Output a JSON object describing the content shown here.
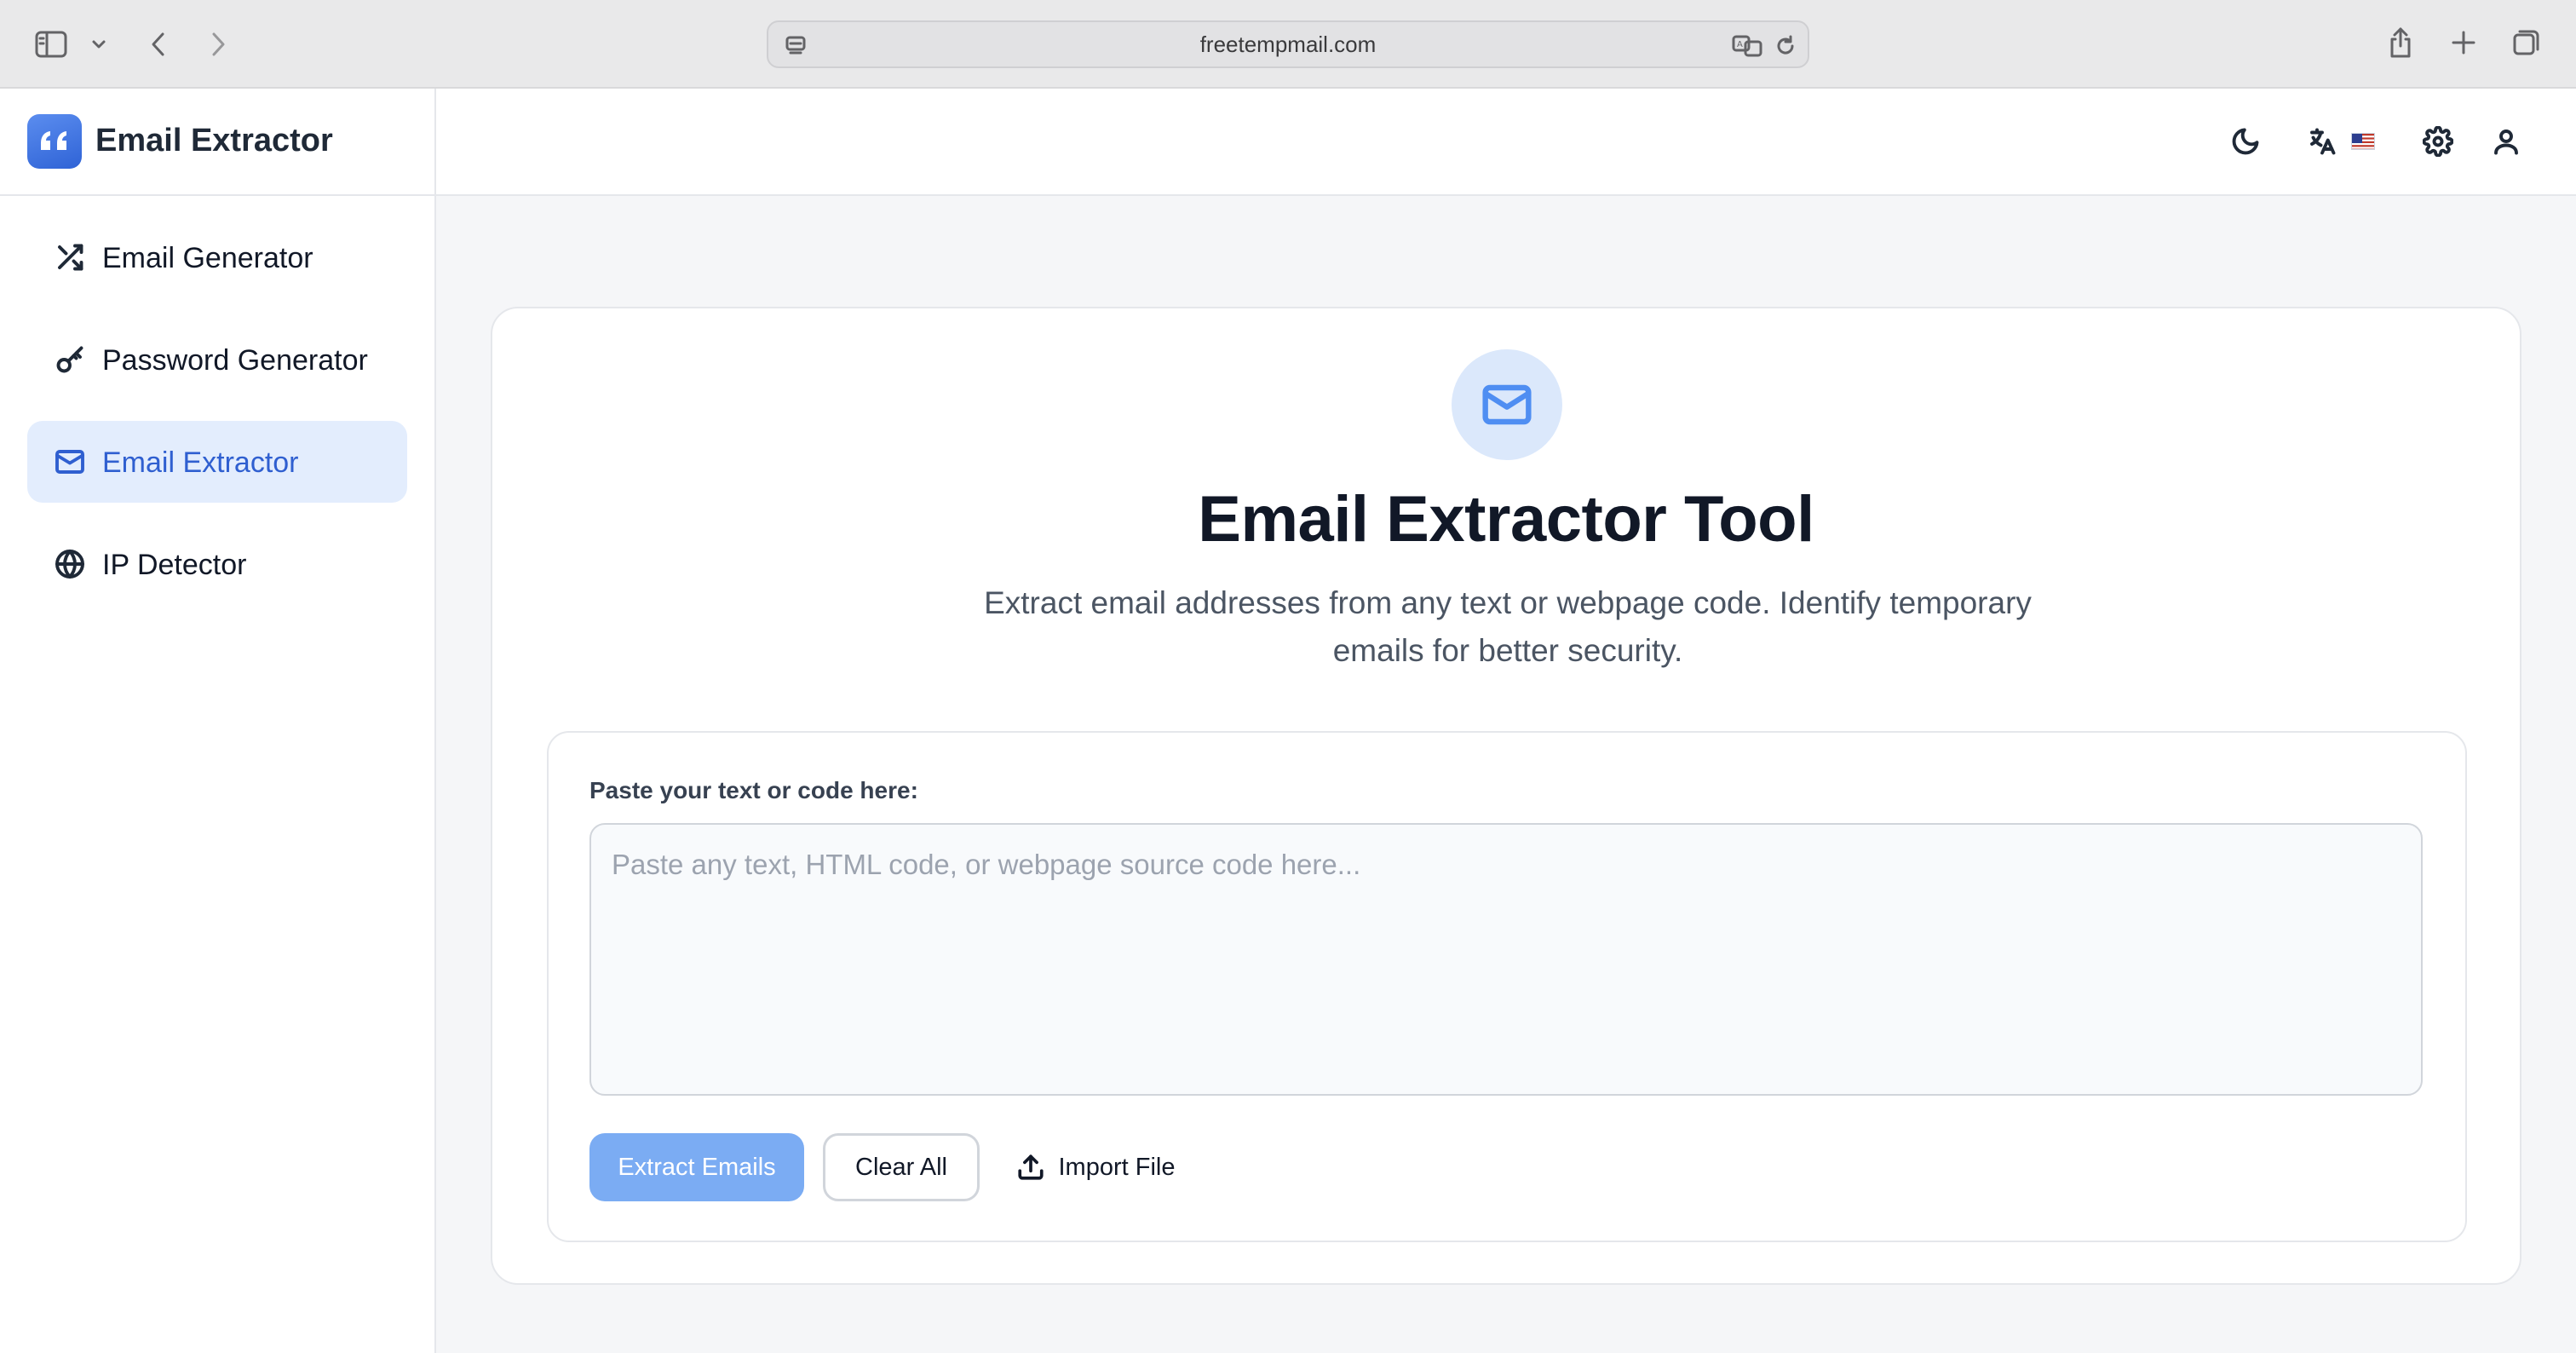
{
  "browser": {
    "url": "freetempmail.com"
  },
  "app": {
    "brand_title": "Email Extractor",
    "accent_color": "#2f5fd0"
  },
  "sidebar": {
    "items": [
      {
        "label": "Email Generator",
        "icon": "shuffle-icon",
        "active": false
      },
      {
        "label": "Password Generator",
        "icon": "key-icon",
        "active": false
      },
      {
        "label": "Email Extractor",
        "icon": "mail-icon",
        "active": true
      },
      {
        "label": "IP Detector",
        "icon": "globe-icon",
        "active": false
      }
    ]
  },
  "topbar": {
    "icons": [
      "moon-icon",
      "translate-icon",
      "us-flag-icon",
      "gear-icon",
      "user-icon"
    ]
  },
  "main": {
    "hero_icon": "mail-icon",
    "title": "Email Extractor Tool",
    "subtitle": "Extract email addresses from any text or webpage code. Identify temporary emails for better security.",
    "form": {
      "label": "Paste your text or code here:",
      "placeholder": "Paste any text, HTML code, or webpage source code here...",
      "value": "",
      "extract_label": "Extract Emails",
      "clear_label": "Clear All",
      "import_label": "Import File"
    }
  }
}
